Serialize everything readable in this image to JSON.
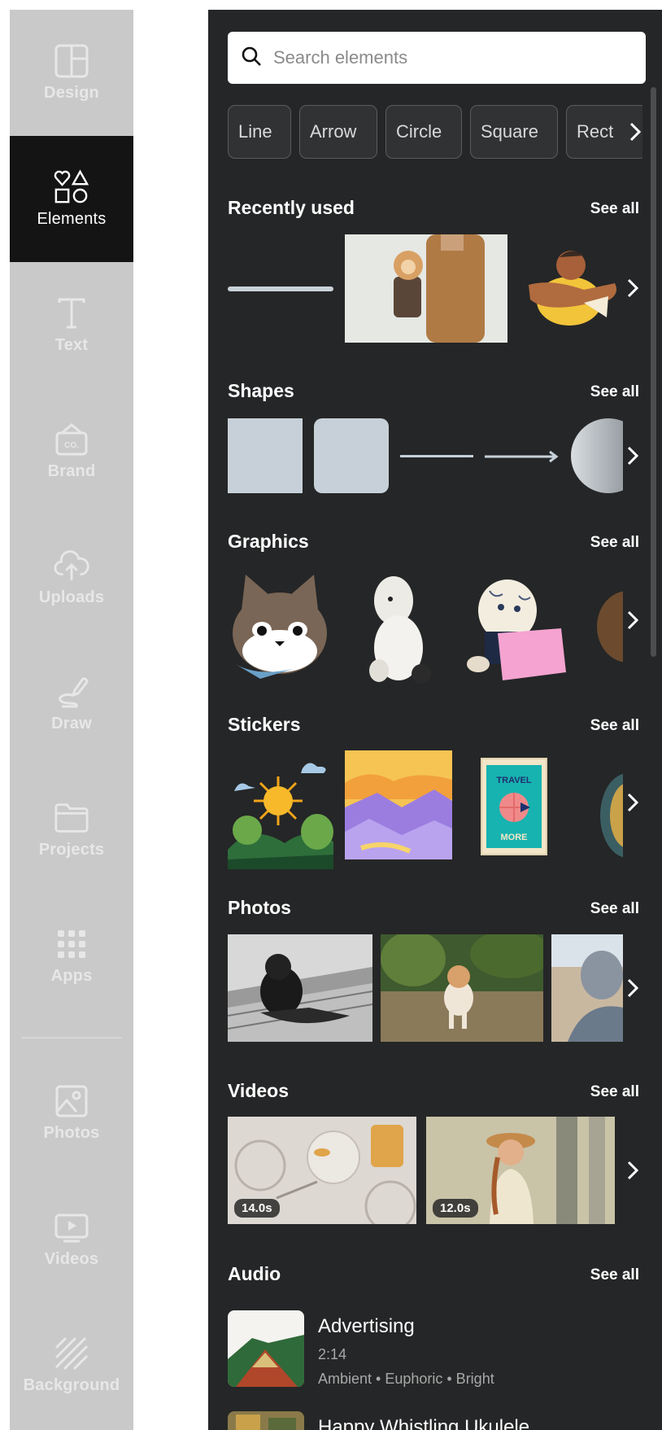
{
  "sidebar": {
    "items": [
      {
        "label": "Design",
        "icon": "layout-icon"
      },
      {
        "label": "Elements",
        "icon": "shapes-icon"
      },
      {
        "label": "Text",
        "icon": "text-icon"
      },
      {
        "label": "Brand",
        "icon": "brand-kit-icon"
      },
      {
        "label": "Uploads",
        "icon": "cloud-upload-icon"
      },
      {
        "label": "Draw",
        "icon": "pen-icon"
      },
      {
        "label": "Projects",
        "icon": "folder-icon"
      },
      {
        "label": "Apps",
        "icon": "grid-icon"
      },
      {
        "label": "Photos",
        "icon": "image-icon"
      },
      {
        "label": "Videos",
        "icon": "video-icon"
      },
      {
        "label": "Background",
        "icon": "background-pattern-icon"
      }
    ],
    "active": "Elements",
    "brand_badge": "CO."
  },
  "search": {
    "placeholder": "Search elements"
  },
  "chips": [
    "Line",
    "Arrow",
    "Circle",
    "Square",
    "Rect"
  ],
  "sections": {
    "recent": {
      "title": "Recently used",
      "see_all": "See all"
    },
    "shapes": {
      "title": "Shapes",
      "see_all": "See all"
    },
    "graphics": {
      "title": "Graphics",
      "see_all": "See all"
    },
    "stickers": {
      "title": "Stickers",
      "see_all": "See all"
    },
    "photos": {
      "title": "Photos",
      "see_all": "See all"
    },
    "videos": {
      "title": "Videos",
      "see_all": "See all",
      "durations": [
        "14.0s",
        "12.0s"
      ]
    },
    "audio": {
      "title": "Audio",
      "see_all": "See all",
      "tracks": [
        {
          "title": "Advertising",
          "duration": "2:14",
          "tags": "Ambient • Euphoric • Bright"
        },
        {
          "title": "Happy Whistling Ukulele"
        }
      ]
    }
  },
  "sticker_text": {
    "top": "TRAVEL",
    "bottom": "MORE"
  },
  "colors": {
    "panel_bg": "#252627",
    "sidebar_bg": "#c9c9c9",
    "active_bg": "#141414",
    "shape_fill": "#c7d0d8"
  }
}
